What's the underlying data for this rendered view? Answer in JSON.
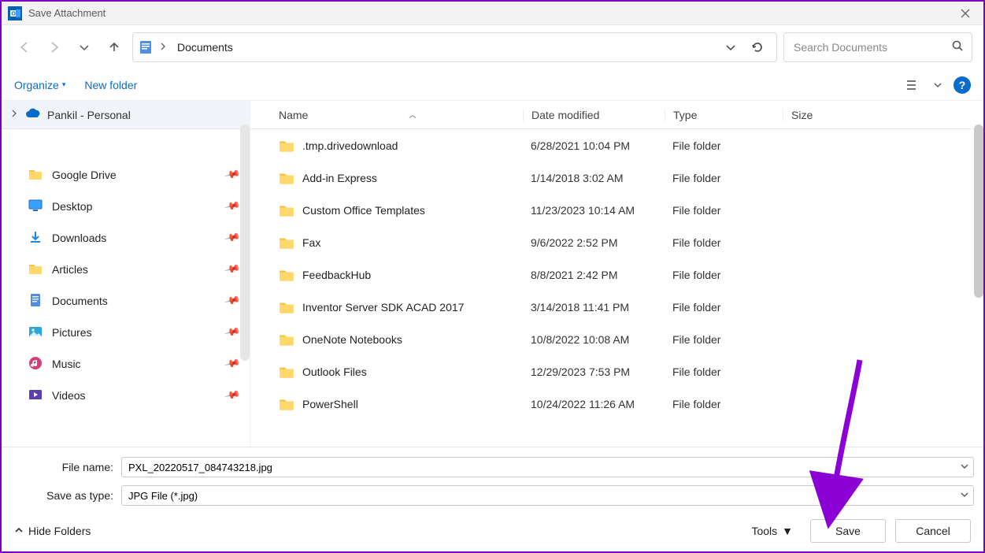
{
  "window": {
    "title": "Save Attachment"
  },
  "address": {
    "location": "Documents"
  },
  "search": {
    "placeholder": "Search Documents"
  },
  "toolbar": {
    "organize": "Organize",
    "newfolder": "New folder"
  },
  "sidebar": {
    "root": "Pankil - Personal",
    "items": [
      {
        "label": "Google Drive",
        "icon": "folder"
      },
      {
        "label": "Desktop",
        "icon": "desktop"
      },
      {
        "label": "Downloads",
        "icon": "download"
      },
      {
        "label": "Articles",
        "icon": "folder"
      },
      {
        "label": "Documents",
        "icon": "document"
      },
      {
        "label": "Pictures",
        "icon": "pictures"
      },
      {
        "label": "Music",
        "icon": "music"
      },
      {
        "label": "Videos",
        "icon": "videos"
      }
    ]
  },
  "columns": {
    "name": "Name",
    "date": "Date modified",
    "type": "Type",
    "size": "Size"
  },
  "rows": [
    {
      "name": ".tmp.drivedownload",
      "date": "6/28/2021 10:04 PM",
      "type": "File folder"
    },
    {
      "name": "Add-in Express",
      "date": "1/14/2018 3:02 AM",
      "type": "File folder"
    },
    {
      "name": "Custom Office Templates",
      "date": "11/23/2023 10:14 AM",
      "type": "File folder"
    },
    {
      "name": "Fax",
      "date": "9/6/2022 2:52 PM",
      "type": "File folder"
    },
    {
      "name": "FeedbackHub",
      "date": "8/8/2021 2:42 PM",
      "type": "File folder"
    },
    {
      "name": "Inventor Server SDK ACAD 2017",
      "date": "3/14/2018 11:41 PM",
      "type": "File folder"
    },
    {
      "name": "OneNote Notebooks",
      "date": "10/8/2022 10:08 AM",
      "type": "File folder"
    },
    {
      "name": "Outlook Files",
      "date": "12/29/2023 7:53 PM",
      "type": "File folder"
    },
    {
      "name": "PowerShell",
      "date": "10/24/2022 11:26 AM",
      "type": "File folder"
    }
  ],
  "form": {
    "filename_label": "File name:",
    "filename_value": "PXL_20220517_084743218.jpg",
    "saveas_label": "Save as type:",
    "saveas_value": "JPG File (*.jpg)"
  },
  "footer": {
    "hide": "Hide Folders",
    "tools": "Tools",
    "save": "Save",
    "cancel": "Cancel"
  }
}
